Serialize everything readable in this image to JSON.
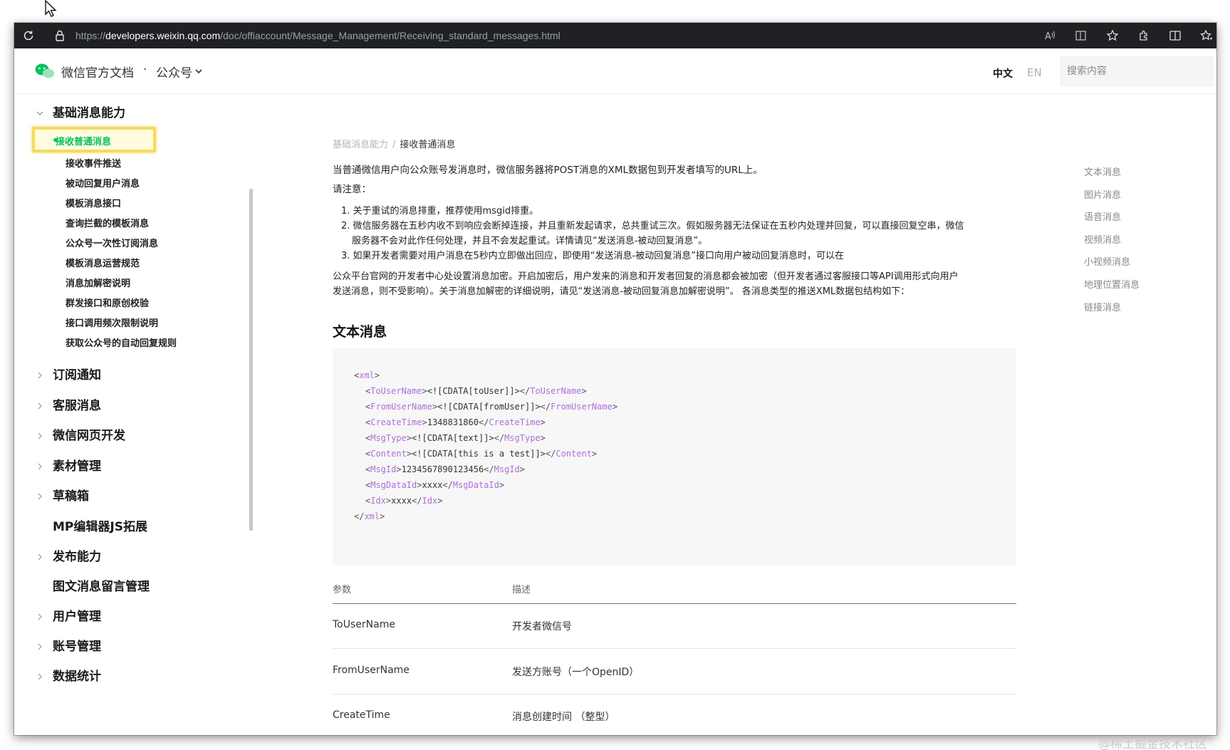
{
  "browser": {
    "url_scheme": "https://",
    "url_domain": "developers.weixin.qq.com",
    "url_path": "/doc/offiaccount/Message_Management/Receiving_standard_messages.html"
  },
  "header": {
    "site_title": "微信官方文档",
    "separator": "·",
    "section": "公众号",
    "lang_zh": "中文",
    "lang_en": "EN",
    "search_placeholder": "搜索内容",
    "accent": "#07c160"
  },
  "sidebar": {
    "open_group": "基础消息能力",
    "active_item": "接收普通消息",
    "items": [
      "接收事件推送",
      "被动回复用户消息",
      "模板消息接口",
      "查询拦截的模板消息",
      "公众号一次性订阅消息",
      "模板消息运营规范",
      "消息加解密说明",
      "群发接口和原创校验",
      "接口调用频次限制说明",
      "获取公众号的自动回复规则"
    ],
    "groups": [
      {
        "label": "订阅通知",
        "arrow": true
      },
      {
        "label": "客服消息",
        "arrow": true
      },
      {
        "label": "微信网页开发",
        "arrow": true
      },
      {
        "label": "素材管理",
        "arrow": true
      },
      {
        "label": "草稿箱",
        "arrow": true
      },
      {
        "label": "MP编辑器JS拓展",
        "arrow": false
      },
      {
        "label": "发布能力",
        "arrow": true
      },
      {
        "label": "图文消息留言管理",
        "arrow": false
      },
      {
        "label": "用户管理",
        "arrow": true
      },
      {
        "label": "账号管理",
        "arrow": true
      },
      {
        "label": "数据统计",
        "arrow": true
      }
    ]
  },
  "main": {
    "breadcrumb": [
      "基础消息能力",
      "接收普通消息"
    ],
    "breadcrumb_sep": "/",
    "intro": "当普通微信用户向公众账号发消息时，微信服务器将POST消息的XML数据包到开发者填写的URL上。",
    "note_title": "请注意：",
    "notes": [
      "1. 关于重试的消息排重，推荐使用msgid排重。",
      "2. 微信服务器在五秒内收不到响应会断掉连接，并且重新发起请求，总共重试三次。假如服务器无法保证在五秒内处理并回复，可以直接回复空串，微信",
      "服务器不会对此作任何处理，并且不会发起重试。详情请见“发送消息-被动回复消息”。",
      "3. 如果开发者需要对用户消息在5秒内立即做出回应，即使用“发送消息-被动回复消息”接口向用户被动回复消息时，可以在"
    ],
    "para2_line1": "公众平台官网的开发者中心处设置消息加密。开启加密后，用户发来的消息和开发者回复的消息都会被加密（但开发者通过客服接口等API调用形式向用户",
    "para2_line2": "发送消息，则不受影响）。关于消息加解密的详细说明，请见“发送消息-被动回复消息加解密说明”。 各消息类型的推送XML数据包结构如下：",
    "section_title": "文本消息",
    "code": {
      "root": "xml",
      "fields": [
        {
          "tag": "ToUserName",
          "value": "<![CDATA[toUser]]>"
        },
        {
          "tag": "FromUserName",
          "value": "<![CDATA[fromUser]]>"
        },
        {
          "tag": "CreateTime",
          "value": "1348831860"
        },
        {
          "tag": "MsgType",
          "value": "<![CDATA[text]]>"
        },
        {
          "tag": "Content",
          "value": "<![CDATA[this is a test]]>"
        },
        {
          "tag": "MsgId",
          "value": "1234567890123456"
        },
        {
          "tag": "MsgDataId",
          "value": "xxxx"
        },
        {
          "tag": "Idx",
          "value": "xxxx"
        }
      ]
    },
    "table": {
      "headers": [
        "参数",
        "描述"
      ],
      "rows": [
        [
          "ToUserName",
          "开发者微信号"
        ],
        [
          "FromUserName",
          "发送方账号（一个OpenID）"
        ],
        [
          "CreateTime",
          "消息创建时间 （整型）"
        ]
      ]
    }
  },
  "toc": [
    "文本消息",
    "图片消息",
    "语音消息",
    "视频消息",
    "小视频消息",
    "地理位置消息",
    "链接消息"
  ],
  "watermark": "@稀土掘金技术社区"
}
